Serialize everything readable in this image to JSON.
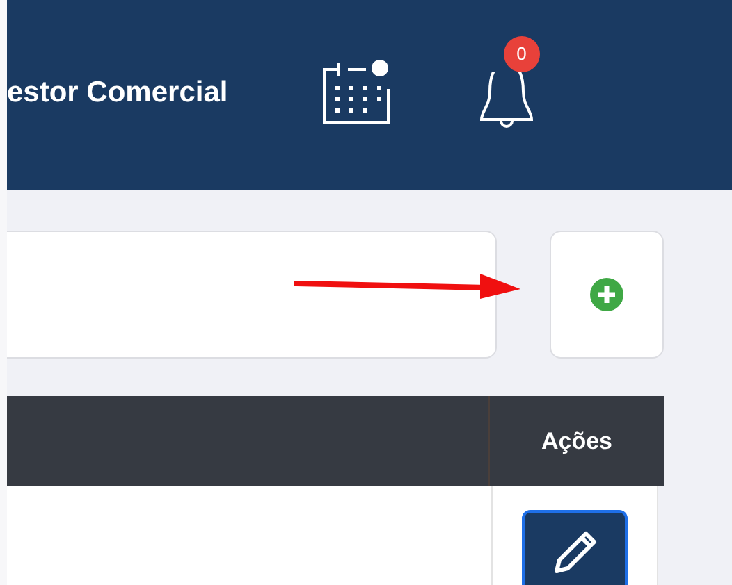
{
  "header": {
    "title": "estor Comercial",
    "notification_count": "0"
  },
  "table": {
    "columns": [
      "Ações"
    ]
  }
}
